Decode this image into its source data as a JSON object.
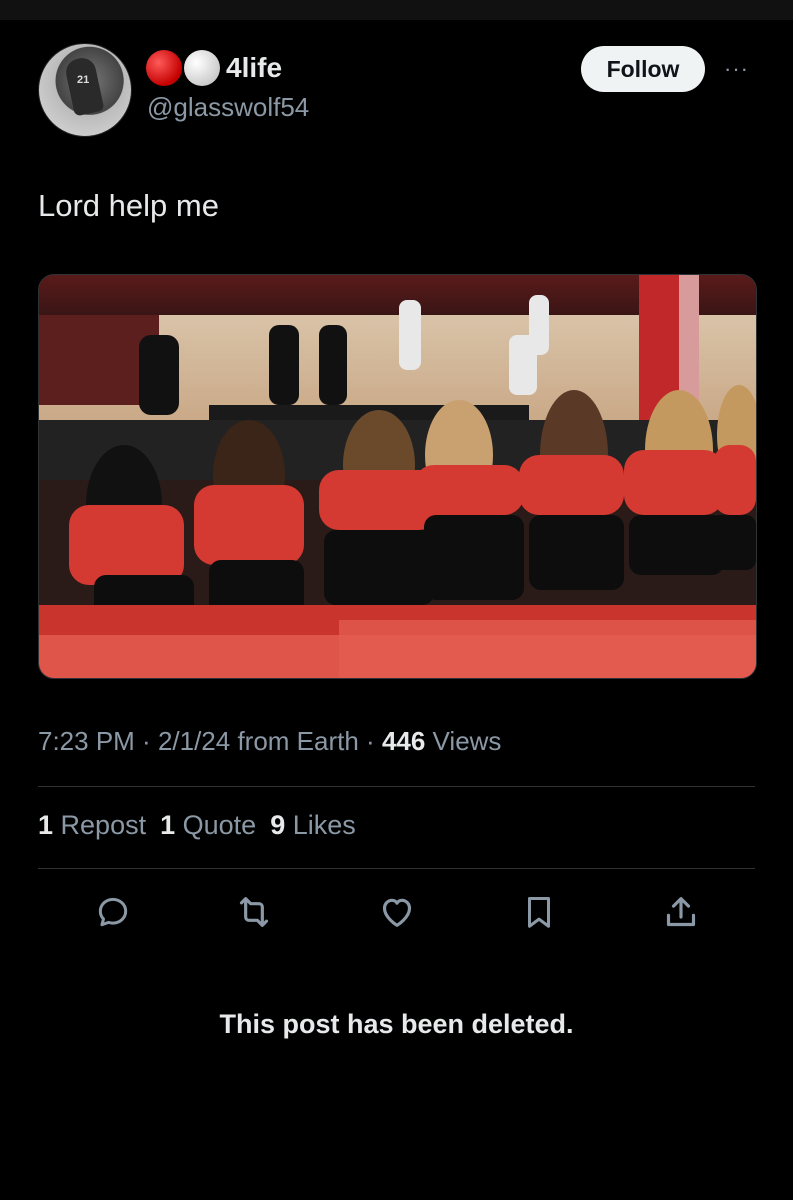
{
  "user": {
    "display_name": "4life",
    "handle": "@glasswolf54",
    "emoji_dots": [
      "red-circle",
      "white-circle"
    ]
  },
  "follow_label": "Follow",
  "more_label": "···",
  "tweet_text": "Lord help me",
  "media": {
    "description_icon": "photo-basketball-arena"
  },
  "meta": {
    "time": "7:23 PM",
    "sep1": " · ",
    "date": "2/1/24",
    "from": " from Earth",
    "sep2": " · ",
    "views_count": "446",
    "views_label": " Views"
  },
  "stats": {
    "reposts_count": "1",
    "reposts_label": " Repost",
    "quotes_count": "1",
    "quotes_label": " Quote",
    "likes_count": "9",
    "likes_label": " Likes"
  },
  "actions": [
    "reply-icon",
    "repost-icon",
    "like-icon",
    "bookmark-icon",
    "share-icon"
  ],
  "deleted_notice": "This post has been deleted.",
  "colors": {
    "background": "#000000",
    "text": "#e7e9ea",
    "secondary": "#8b98a5",
    "divider": "#2f3336"
  }
}
